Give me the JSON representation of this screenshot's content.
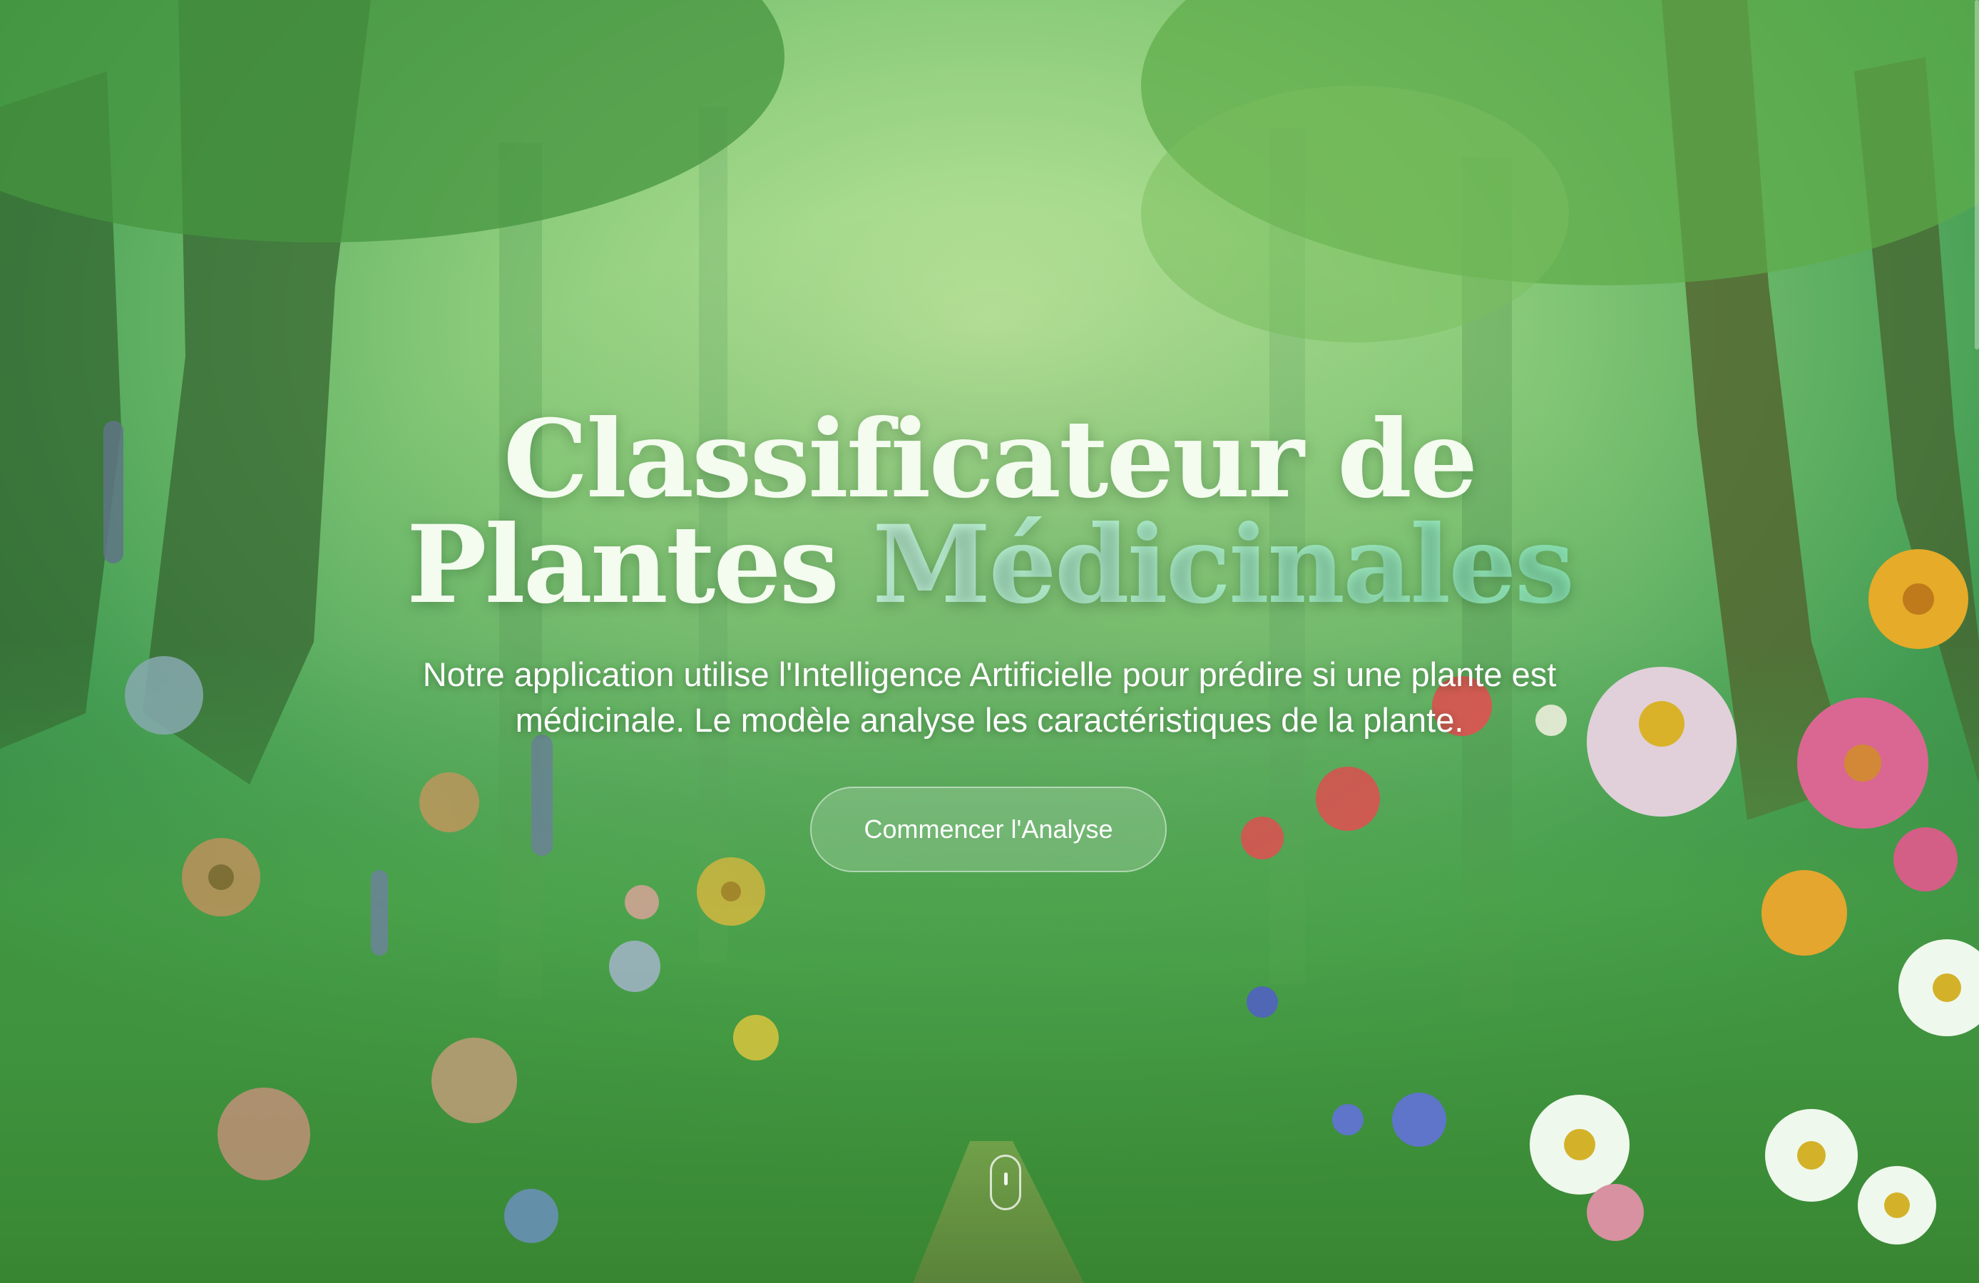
{
  "hero": {
    "title_line1": "Classificateur de",
    "title_line2_plain": "Plantes ",
    "title_line2_accent": "Médicinales",
    "subtitle": "Notre application utilise l'Intelligence Artificielle pour prédire si une plante est médicinale. Le modèle analyse les caractéristiques de la plante.",
    "cta_label": "Commencer l'Analyse"
  },
  "icons": {
    "scroll": "mouse-scroll-icon"
  },
  "colors": {
    "title": "#f4fbef",
    "title_accent": "#aef2cf",
    "button_bg": "rgba(255,255,255,0.18)",
    "background_green": "#2f8a3e"
  }
}
